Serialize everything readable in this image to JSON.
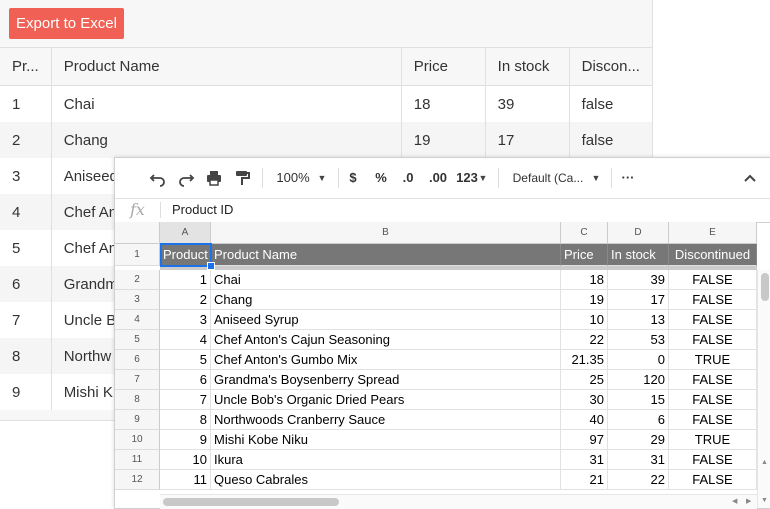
{
  "grid": {
    "export_label": "Export to Excel",
    "columns": [
      "Pr...",
      "Product Name",
      "Price",
      "In stock",
      "Discon..."
    ],
    "rows": [
      [
        "1",
        "Chai",
        "18",
        "39",
        "false"
      ],
      [
        "2",
        "Chang",
        "19",
        "17",
        "false"
      ],
      [
        "3",
        "Aniseed",
        "",
        "",
        ""
      ],
      [
        "4",
        "Chef An",
        "",
        "",
        ""
      ],
      [
        "5",
        "Chef An",
        "",
        "",
        ""
      ],
      [
        "6",
        "Grandm",
        "",
        "",
        ""
      ],
      [
        "7",
        "Uncle B",
        "",
        "",
        ""
      ],
      [
        "8",
        "Northw",
        "",
        "",
        ""
      ],
      [
        "9",
        "Mishi K",
        "",
        "",
        ""
      ]
    ]
  },
  "sheet": {
    "toolbar": {
      "zoom": "100%",
      "currency": "$",
      "percent": "%",
      "dec_less": ".0",
      "dec_more": ".00",
      "number_format": "123",
      "font": "Default (Ca...",
      "more": "···"
    },
    "formula": {
      "fx": "fx",
      "value": "Product ID"
    },
    "col_letters": [
      "A",
      "B",
      "C",
      "D",
      "E"
    ],
    "row_numbers": [
      "1",
      "2",
      "3",
      "4",
      "5",
      "6",
      "7",
      "8",
      "9",
      "10",
      "11",
      "12"
    ],
    "header": [
      "Product ID",
      "Product Name",
      "Price",
      "In stock",
      "Discontinued"
    ],
    "rows": [
      [
        "1",
        "Chai",
        "18",
        "39",
        "FALSE"
      ],
      [
        "2",
        "Chang",
        "19",
        "17",
        "FALSE"
      ],
      [
        "3",
        "Aniseed Syrup",
        "10",
        "13",
        "FALSE"
      ],
      [
        "4",
        "Chef Anton's Cajun Seasoning",
        "22",
        "53",
        "FALSE"
      ],
      [
        "5",
        "Chef Anton's Gumbo Mix",
        "21.35",
        "0",
        "TRUE"
      ],
      [
        "6",
        "Grandma's Boysenberry Spread",
        "25",
        "120",
        "FALSE"
      ],
      [
        "7",
        "Uncle Bob's Organic Dried Pears",
        "30",
        "15",
        "FALSE"
      ],
      [
        "8",
        "Northwoods Cranberry Sauce",
        "40",
        "6",
        "FALSE"
      ],
      [
        "9",
        "Mishi Kobe Niku",
        "97",
        "29",
        "TRUE"
      ],
      [
        "10",
        "Ikura",
        "31",
        "31",
        "FALSE"
      ],
      [
        "11",
        "Queso Cabrales",
        "21",
        "22",
        "FALSE"
      ]
    ]
  }
}
